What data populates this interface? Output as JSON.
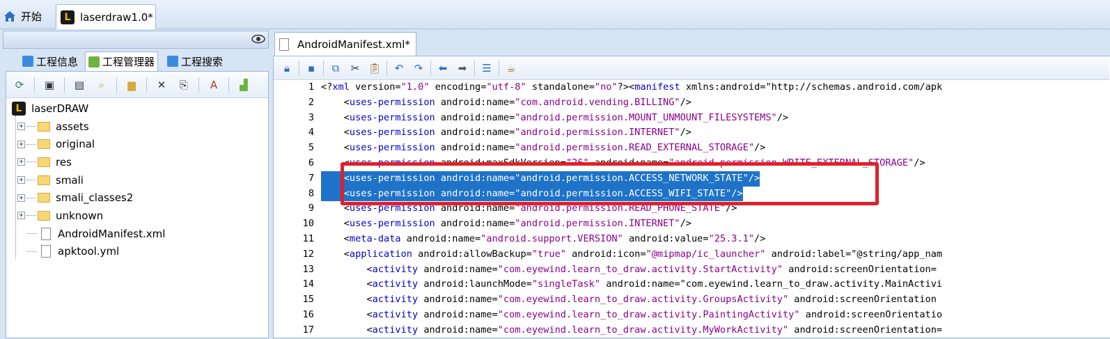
{
  "top_tabs": [
    {
      "label": "开始"
    },
    {
      "label": "laserdraw1.0*"
    }
  ],
  "left_tabs": [
    {
      "label": "工程信息"
    },
    {
      "label": "工程管理器"
    },
    {
      "label": "工程搜索"
    }
  ],
  "tree": {
    "root": "laserDRAW",
    "items": [
      {
        "label": "assets",
        "kind": "folder"
      },
      {
        "label": "original",
        "kind": "folder"
      },
      {
        "label": "res",
        "kind": "folder"
      },
      {
        "label": "smali",
        "kind": "folder"
      },
      {
        "label": "smali_classes2",
        "kind": "folder"
      },
      {
        "label": "unknown",
        "kind": "folder"
      },
      {
        "label": "AndroidManifest.xml",
        "kind": "file"
      },
      {
        "label": "apktool.yml",
        "kind": "file"
      }
    ]
  },
  "editor": {
    "tab_label": "AndroidManifest.xml*",
    "lines": [
      {
        "n": "1",
        "text": "<?xml version=\"1.0\" encoding=\"utf-8\" standalone=\"no\"?><manifest xmlns:android=\"http://schemas.android.com/apk"
      },
      {
        "n": "2",
        "text": "    <uses-permission android:name=\"com.android.vending.BILLING\"/>"
      },
      {
        "n": "3",
        "text": "    <uses-permission android:name=\"android.permission.MOUNT_UNMOUNT_FILESYSTEMS\"/>"
      },
      {
        "n": "4",
        "text": "    <uses-permission android:name=\"android.permission.INTERNET\"/>"
      },
      {
        "n": "5",
        "text": "    <uses-permission android:name=\"android.permission.READ_EXTERNAL_STORAGE\"/>"
      },
      {
        "n": "6",
        "text": "    <uses-permission android:maxSdkVersion=\"26\" android:name=\"android.permission.WRITE_EXTERNAL_STORAGE\"/>"
      },
      {
        "n": "7",
        "text": "    <uses-permission android:name=\"android.permission.ACCESS_NETWORK_STATE\"/>"
      },
      {
        "n": "8",
        "text": "    <uses-permission android:name=\"android.permission.ACCESS_WIFI_STATE\"/>"
      },
      {
        "n": "9",
        "text": "    <uses-permission android:name=\"android.permission.READ_PHONE_STATE\"/>"
      },
      {
        "n": "10",
        "text": "    <uses-permission android:name=\"android.permission.INTERNET\"/>"
      },
      {
        "n": "11",
        "text": "    <meta-data android:name=\"android.support.VERSION\" android:value=\"25.3.1\"/>"
      },
      {
        "n": "12",
        "text": "    <application android:allowBackup=\"true\" android:icon=\"@mipmap/ic_launcher\" android:label=\"@string/app_nam"
      },
      {
        "n": "13",
        "text": "        <activity android:name=\"com.eyewind.learn_to_draw.activity.StartActivity\" android:screenOrientation="
      },
      {
        "n": "14",
        "text": "        <activity android:launchMode=\"singleTask\" android:name=\"com.eyewind.learn_to_draw.activity.MainActivi"
      },
      {
        "n": "15",
        "text": "        <activity android:name=\"com.eyewind.learn_to_draw.activity.GroupsActivity\" android:screenOrientation"
      },
      {
        "n": "16",
        "text": "        <activity android:name=\"com.eyewind.learn_to_draw.activity.PaintingActivity\" android:screenOrientatio"
      },
      {
        "n": "17",
        "text": "        <activity android:name=\"com.eyewind.learn_to_draw.activity.MyWorkActivity\" android:screenOrientation="
      }
    ],
    "selected_lines": [
      "7",
      "8"
    ]
  },
  "colors": {
    "selection": "#1e73c8",
    "highlight_box": "#e0202a",
    "tag": "#0000c8",
    "value": "#8b008b"
  }
}
